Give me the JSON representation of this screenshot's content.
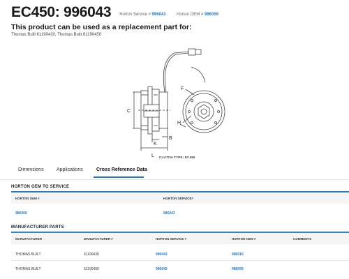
{
  "header": {
    "title": "EC450: 996043",
    "horton_service_label": "Horton Service #",
    "horton_service_value": "996043",
    "horton_oem_label": "Horton OEM #",
    "horton_oem_value": "986059"
  },
  "replacement": {
    "heading": "This product can be used as a replacement part for:",
    "parts": "Thomas Built 61190430, Thomas Built 61190450"
  },
  "diagram": {
    "caption": "CLUTCH TYPE: EC450",
    "labels": {
      "c": "C",
      "b": "B",
      "k": "K",
      "l": "L",
      "f": "F",
      "h": "H"
    }
  },
  "tabs": [
    {
      "label": "Dimensions",
      "active": false
    },
    {
      "label": "Applications",
      "active": false
    },
    {
      "label": "Cross Reference Data",
      "active": true
    }
  ],
  "oem_section": {
    "title": "HORTON OEM TO SERVICE",
    "columns": [
      "HORTON OEM #",
      "HORTON SERVICE#"
    ],
    "rows": [
      [
        "986059",
        "996043"
      ]
    ]
  },
  "manufacturer_section": {
    "title": "MANUFACTURER PARTS",
    "columns": [
      "MANUFACTURER",
      "MANUFACTURER #",
      "HORTON SERVICE #",
      "HORTON OEM #",
      "COMMENTS"
    ],
    "rows": [
      [
        "THOMAS BUILT",
        "61190430",
        "996043",
        "986010",
        ""
      ],
      [
        "THOMAS BUILT",
        "61190450",
        "996043",
        "986059",
        ""
      ]
    ]
  },
  "colors": {
    "accent": "#1f78c8",
    "rule": "#2f7fc3"
  }
}
